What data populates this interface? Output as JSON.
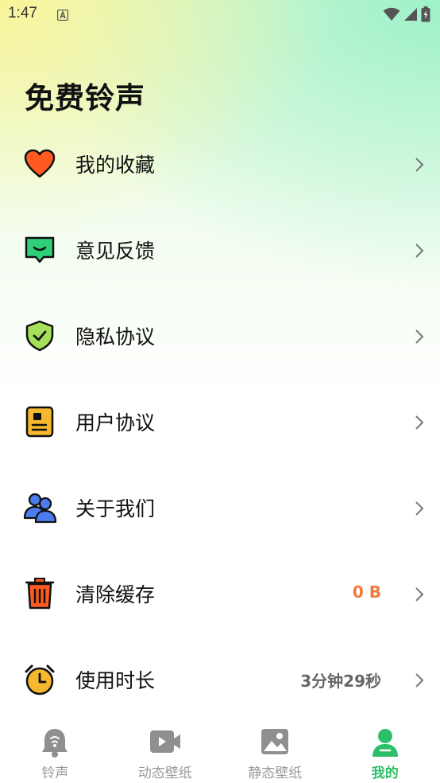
{
  "status_bar": {
    "time": "1:47"
  },
  "page_title": "免费铃声",
  "menu": [
    {
      "label": "我的收藏",
      "icon": "heart-icon",
      "value": ""
    },
    {
      "label": "意见反馈",
      "icon": "feedback-chat-icon",
      "value": ""
    },
    {
      "label": "隐私协议",
      "icon": "shield-check-icon",
      "value": ""
    },
    {
      "label": "用户协议",
      "icon": "document-icon",
      "value": ""
    },
    {
      "label": "关于我们",
      "icon": "users-icon",
      "value": ""
    },
    {
      "label": "清除缓存",
      "icon": "trash-icon",
      "value": "0 B"
    },
    {
      "label": "使用时长",
      "icon": "alarm-clock-icon",
      "value": "3分钟29秒"
    }
  ],
  "tabs": [
    {
      "label": "铃声",
      "icon": "bell-icon",
      "active": false
    },
    {
      "label": "动态壁纸",
      "icon": "video-icon",
      "active": false
    },
    {
      "label": "静态壁纸",
      "icon": "image-icon",
      "active": false
    },
    {
      "label": "我的",
      "icon": "profile-icon",
      "active": true
    }
  ],
  "colors": {
    "accent": "#2dbf67",
    "cache_value": "#f07a3a",
    "heart": "#ff5a1f",
    "feedback": "#2fd07a",
    "shield": "#a5e05a",
    "document": "#f5b82e",
    "users": "#4b7df0",
    "trash": "#ff5a1f",
    "clock": "#f5b82e"
  }
}
